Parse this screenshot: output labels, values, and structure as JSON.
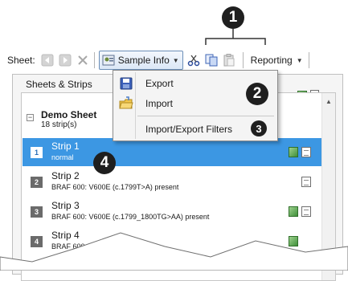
{
  "callouts": {
    "c1": "1",
    "c2": "2",
    "c3": "3",
    "c4": "4"
  },
  "toolbar": {
    "sheet_label": "Sheet:",
    "sample_info_label": "Sample Info",
    "reporting_label": "Reporting"
  },
  "panel": {
    "title": "Sheets & Strips"
  },
  "sheet": {
    "name": "Demo Sheet",
    "count": "18 strip(s)"
  },
  "menu": {
    "items": [
      {
        "label": "Export",
        "icon": "export-icon"
      },
      {
        "label": "Import",
        "icon": "import-icon"
      },
      {
        "label": "Import/Export Filters",
        "icon": ""
      }
    ]
  },
  "strips": [
    {
      "num": "1",
      "name": "Strip 1",
      "desc": "normal",
      "icons": [
        "green-square-icon",
        "document-icon"
      ]
    },
    {
      "num": "2",
      "name": "Strip 2",
      "desc": "BRAF 600: V600E (c.1799T>A) present",
      "icons": [
        "document-icon"
      ]
    },
    {
      "num": "3",
      "name": "Strip 3",
      "desc": "BRAF 600: V600E (c.1799_1800TG>AA) present",
      "icons": [
        "green-square-icon",
        "document-icon"
      ]
    },
    {
      "num": "4",
      "name": "Strip 4",
      "desc": "BRAF 600",
      "icons": [
        "green-square-icon"
      ]
    }
  ],
  "colors": {
    "selection": "#3c97e3",
    "callout": "#1f1f1f",
    "menu_bg": "#f4f4f4"
  }
}
